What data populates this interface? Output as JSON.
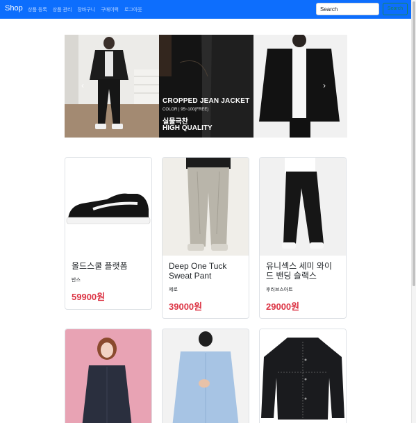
{
  "navbar": {
    "brand": "Shop",
    "links": [
      "상품 등록",
      "상품 관리",
      "장바구니",
      "구매이력",
      "로그아웃"
    ],
    "search_placeholder": "Search",
    "search_button": "Search",
    "color": "#0d6efd"
  },
  "carousel": {
    "title": "CROPPED JEAN JACKET",
    "subtitle": "COLOR | 95~100(FREE)",
    "tagline_kr": "실물극찬",
    "tagline_en": "HIGH QUALITY",
    "prev_icon": "chevron-left-icon",
    "next_icon": "chevron-right-icon"
  },
  "products": [
    {
      "name": "올드스쿨 플랫폼",
      "brand": "반스",
      "price": "59900원"
    },
    {
      "name": "Deep One Tuck Sweat Pant",
      "brand": "제로",
      "price": "39000원"
    },
    {
      "name": "유니섹스 세미 와이드 밴딩 슬랙스",
      "brand": "후러브스아트",
      "price": "29000원"
    },
    {
      "name": "",
      "brand": "",
      "price": ""
    },
    {
      "name": "",
      "brand": "",
      "price": ""
    },
    {
      "name": "",
      "brand": "",
      "price": ""
    }
  ],
  "colors": {
    "price": "#dc3545",
    "search_button": "#198754"
  }
}
